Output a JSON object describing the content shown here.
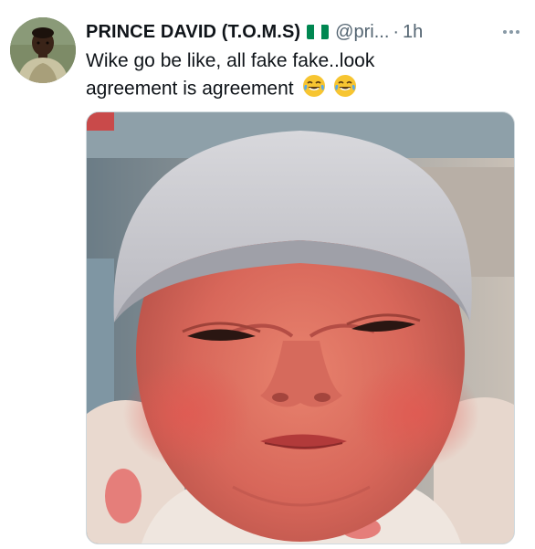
{
  "tweet": {
    "display_name": "PRINCE DAVID (T.O.M.S)",
    "flag_icon": "nigeria-flag-icon",
    "handle": "@pri...",
    "separator": "·",
    "time": "1h",
    "text_line1": "Wike go be like, all fake fake..look",
    "text_line2": "agreement is agreement",
    "emoji_icons": [
      "face-with-tears-of-joy-icon",
      "face-with-tears-of-joy-icon"
    ],
    "more_icon": "more-horizontal-icon",
    "media_description_icon": "photo"
  },
  "colors": {
    "name": "#0f1419",
    "secondary": "#536471",
    "border": "#cfd9de",
    "flag_green": "#008751"
  }
}
